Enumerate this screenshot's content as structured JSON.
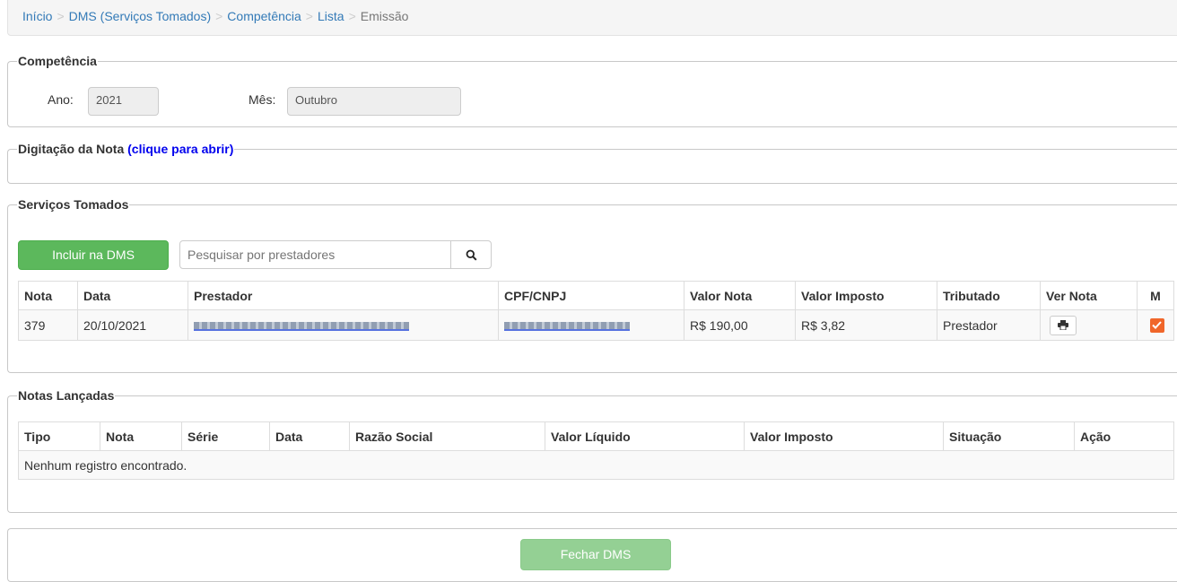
{
  "breadcrumb": {
    "items": [
      "Início",
      "DMS (Serviços Tomados)",
      "Competência",
      "Lista"
    ],
    "active": "Emissão",
    "separator": ">"
  },
  "competencia": {
    "legend": "Competência",
    "ano_label": "Ano:",
    "ano_value": "2021",
    "mes_label": "Mês:",
    "mes_value": "Outubro"
  },
  "digitacao": {
    "legend": "Digitação da Nota",
    "link": "(clique para abrir)"
  },
  "servicos": {
    "legend": "Serviços Tomados",
    "include_button": "Incluir na DMS",
    "search_placeholder": "Pesquisar por prestadores",
    "columns": [
      "Nota",
      "Data",
      "Prestador",
      "CPF/CNPJ",
      "Valor Nota",
      "Valor Imposto",
      "Tributado",
      "Ver Nota",
      "M"
    ],
    "rows": [
      {
        "nota": "379",
        "data": "20/10/2021",
        "prestador": "RAFAEL JARDIM DE PAULA - ME",
        "cpf_cnpj": "00.000.000/0001-00",
        "valor_nota": "R$ 190,00",
        "valor_imposto": "R$ 3,82",
        "tributado": "Prestador",
        "checked": true
      }
    ]
  },
  "notas": {
    "legend": "Notas Lançadas",
    "columns": [
      "Tipo",
      "Nota",
      "Série",
      "Data",
      "Razão Social",
      "Valor Líquido",
      "Valor Imposto",
      "Situação",
      "Ação"
    ],
    "empty_message": "Nenhum registro encontrado."
  },
  "footer": {
    "close_button": "Fechar DMS"
  },
  "colors": {
    "link": "#337ab7",
    "success": "#5cb85c",
    "checkbox": "#f0662a"
  }
}
